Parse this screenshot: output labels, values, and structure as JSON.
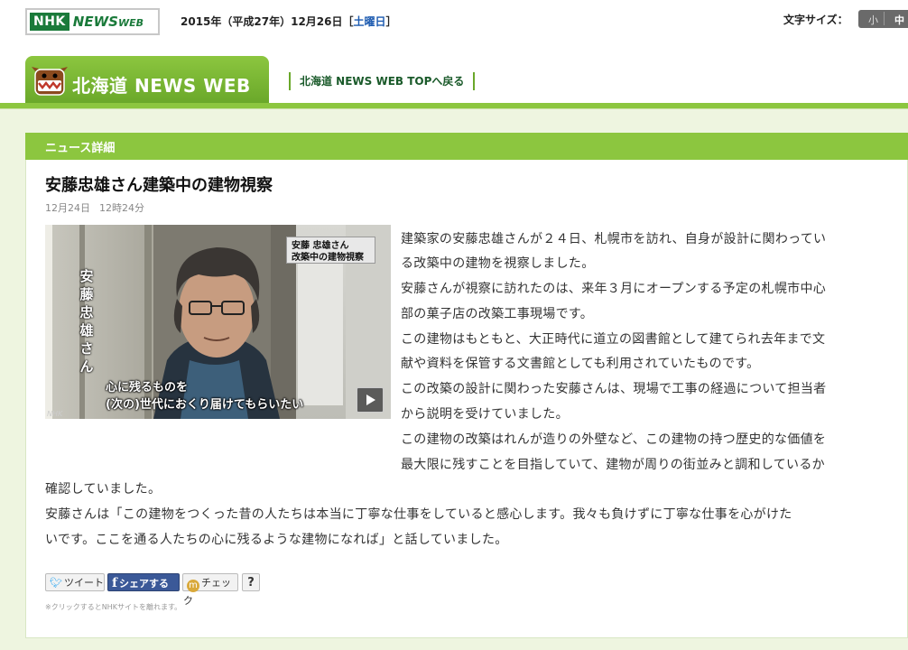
{
  "site": {
    "nhk_logo": "NHK",
    "newsweb_logo": "NEWS",
    "newsweb_logo_small": "WEB",
    "date_text": "2015年（平成27年）12月26日［",
    "day_of_week": "土曜日",
    "date_close": "］",
    "font_size_label": "文字サイズ：",
    "font_size_small": "小",
    "font_size_medium": "中"
  },
  "header": {
    "region_title": "北海道 NEWS WEB",
    "top_link": "北海道 NEWS WEB TOPへ戻る"
  },
  "section": {
    "label": "ニュース詳細"
  },
  "article": {
    "title": "安藤忠雄さん建築中の建物視察",
    "date": "12月24日",
    "time": "12時24分",
    "video": {
      "tag_line1": "安藤 忠雄さん",
      "tag_line2": "改築中の建物視察",
      "name_vertical": "安藤 忠雄さん",
      "subtitle_line1": "心に残るものを",
      "subtitle_line2": "(次の)世代におくり届けてもらいたい",
      "play_icon": "play-icon",
      "watermark": "NHK"
    },
    "lines": [
      "建築家の安藤忠雄さんが２４日、札幌市を訪れ、自身が設計に関わってい",
      "る改築中の建物を視察しました。",
      "安藤さんが視察に訪れたのは、来年３月にオープンする予定の札幌市中心",
      "部の菓子店の改築工事現場です。",
      "この建物はもともと、大正時代に道立の図書館として建てられ去年まで文",
      "献や資料を保管する文書館としても利用されていたものです。",
      "この改築の設計に関わった安藤さんは、現場で工事の経過について担当者",
      "から説明を受けていました。",
      "この建物の改築はれんが造りの外壁など、この建物の持つ歴史的な価値を",
      "最大限に残すことを目指していて、建物が周りの街並みと調和しているか",
      "確認していました。",
      "安藤さんは「この建物をつくった昔の人たちは本当に丁寧な仕事をしていると感心します。我々も負けずに丁寧な仕事を心がけた",
      "いです。ここを通る人たちの心に残るような建物になれば」と話していました。"
    ]
  },
  "social": {
    "tweet": "ツイート",
    "share": "シェアする",
    "check": "チェック",
    "help": "?",
    "note": "※クリックするとNHKサイトを離れます。"
  },
  "colors": {
    "accent_green": "#8cc63f",
    "dark_green": "#1a7a3a",
    "facebook_blue": "#3b5998",
    "page_bg": "#eef5e0"
  }
}
